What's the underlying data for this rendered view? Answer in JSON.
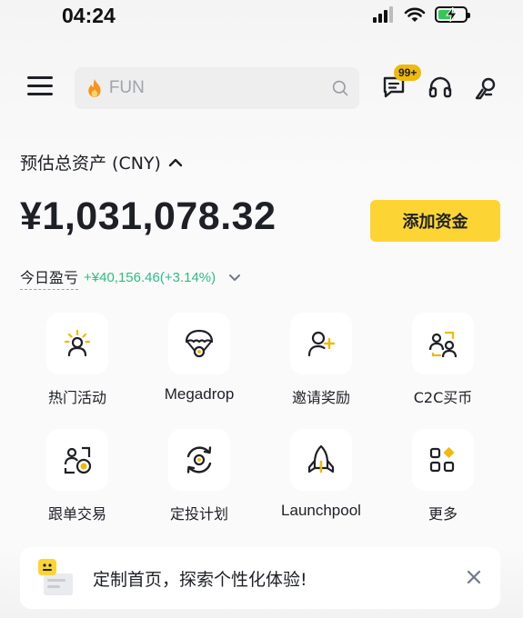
{
  "status_bar": {
    "time": "04:24",
    "icons": [
      "signal-icon",
      "wifi-icon",
      "battery-charging-icon"
    ]
  },
  "header": {
    "menu_icon": "hamburger-menu-icon",
    "search": {
      "icon": "fire-icon",
      "placeholder": "FUN",
      "search_icon": "magnifier-icon"
    },
    "messages": {
      "icon": "chat-icon",
      "badge": "99+"
    },
    "support_icon": "headset-icon",
    "profile_icon": "user-profile-icon"
  },
  "assets": {
    "label": "预估总资产 (CNY)",
    "balance": "¥1,031,078.32",
    "add_funds_label": "添加资金",
    "pnl_label": "今日盈亏",
    "pnl_value": "+¥40,156.46(+3.14%)"
  },
  "shortcuts": [
    {
      "label": "热门活动",
      "icon": "hot-events-icon"
    },
    {
      "label": "Megadrop",
      "icon": "parachute-icon"
    },
    {
      "label": "邀请奖励",
      "icon": "invite-user-icon"
    },
    {
      "label": "C2C买币",
      "icon": "c2c-users-icon"
    },
    {
      "label": "跟单交易",
      "icon": "copy-trading-icon"
    },
    {
      "label": "定投计划",
      "icon": "recurring-buy-icon"
    },
    {
      "label": "Launchpool",
      "icon": "rocket-icon"
    },
    {
      "label": "更多",
      "icon": "more-grid-icon"
    }
  ],
  "banner": {
    "text": "定制首页，探索个性化体验!",
    "close_icon": "close-icon"
  },
  "colors": {
    "accent_yellow": "#FCD535",
    "positive_green": "#2EBD85",
    "text_primary": "#1E2026"
  }
}
